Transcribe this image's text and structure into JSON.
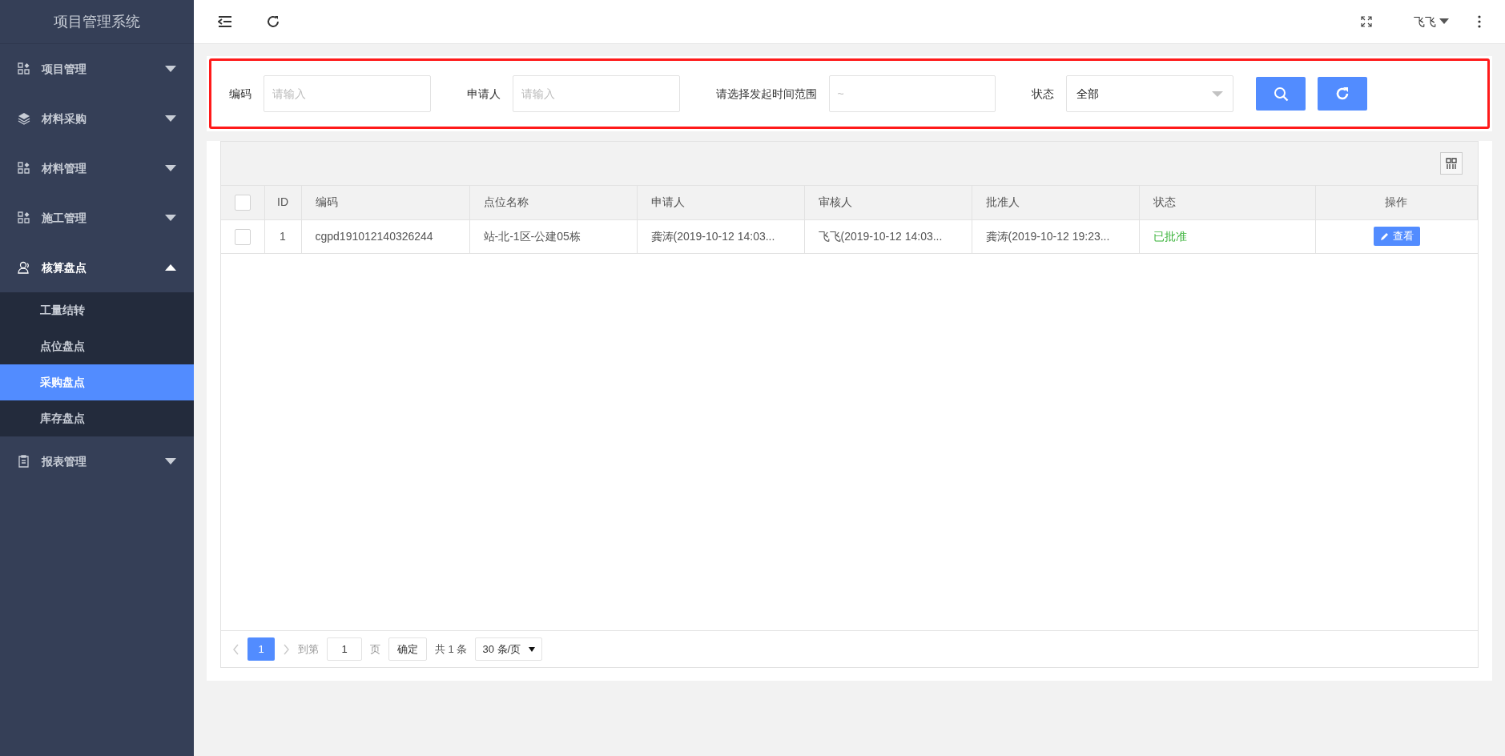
{
  "app_title": "项目管理系统",
  "sidebar": {
    "items": [
      {
        "label": "项目管理",
        "expanded": false
      },
      {
        "label": "材料采购",
        "expanded": false
      },
      {
        "label": "材料管理",
        "expanded": false
      },
      {
        "label": "施工管理",
        "expanded": false
      },
      {
        "label": "核算盘点",
        "expanded": true,
        "children": [
          {
            "label": "工量结转",
            "selected": false
          },
          {
            "label": "点位盘点",
            "selected": false
          },
          {
            "label": "采购盘点",
            "selected": true
          },
          {
            "label": "库存盘点",
            "selected": false
          }
        ]
      },
      {
        "label": "报表管理",
        "expanded": false
      }
    ]
  },
  "header": {
    "user": "飞飞"
  },
  "filters": [
    {
      "kind": "input",
      "label": "编码",
      "placeholder": "请输入"
    },
    {
      "kind": "input",
      "label": "申请人",
      "placeholder": "请输入"
    },
    {
      "kind": "input",
      "label": "请选择发起时间范围",
      "placeholder": "~"
    },
    {
      "kind": "select",
      "label": "状态",
      "value": "全部"
    }
  ],
  "table": {
    "columns": [
      "ID",
      "编码",
      "点位名称",
      "申请人",
      "审核人",
      "批准人",
      "状态",
      "操作"
    ],
    "header_checked": false,
    "rows": [
      {
        "checked": false,
        "cells": [
          "1",
          "cgpd191012140326244",
          "站-北-1区-公建05栋",
          "龚涛(2019-10-12 14:03...",
          "飞飞(2019-10-12 14:03...",
          "龚涛(2019-10-12 19:23...",
          "已批准"
        ],
        "color": "#3cb43c",
        "action": "查看"
      }
    ]
  },
  "pagination": {
    "pages": [
      {
        "label": "1",
        "selected": true
      }
    ],
    "goto_label": "到第",
    "goto_value": "1",
    "page_unit": "页",
    "confirm": "确定",
    "total": "共 1 条",
    "page_size": "30 条/页"
  }
}
